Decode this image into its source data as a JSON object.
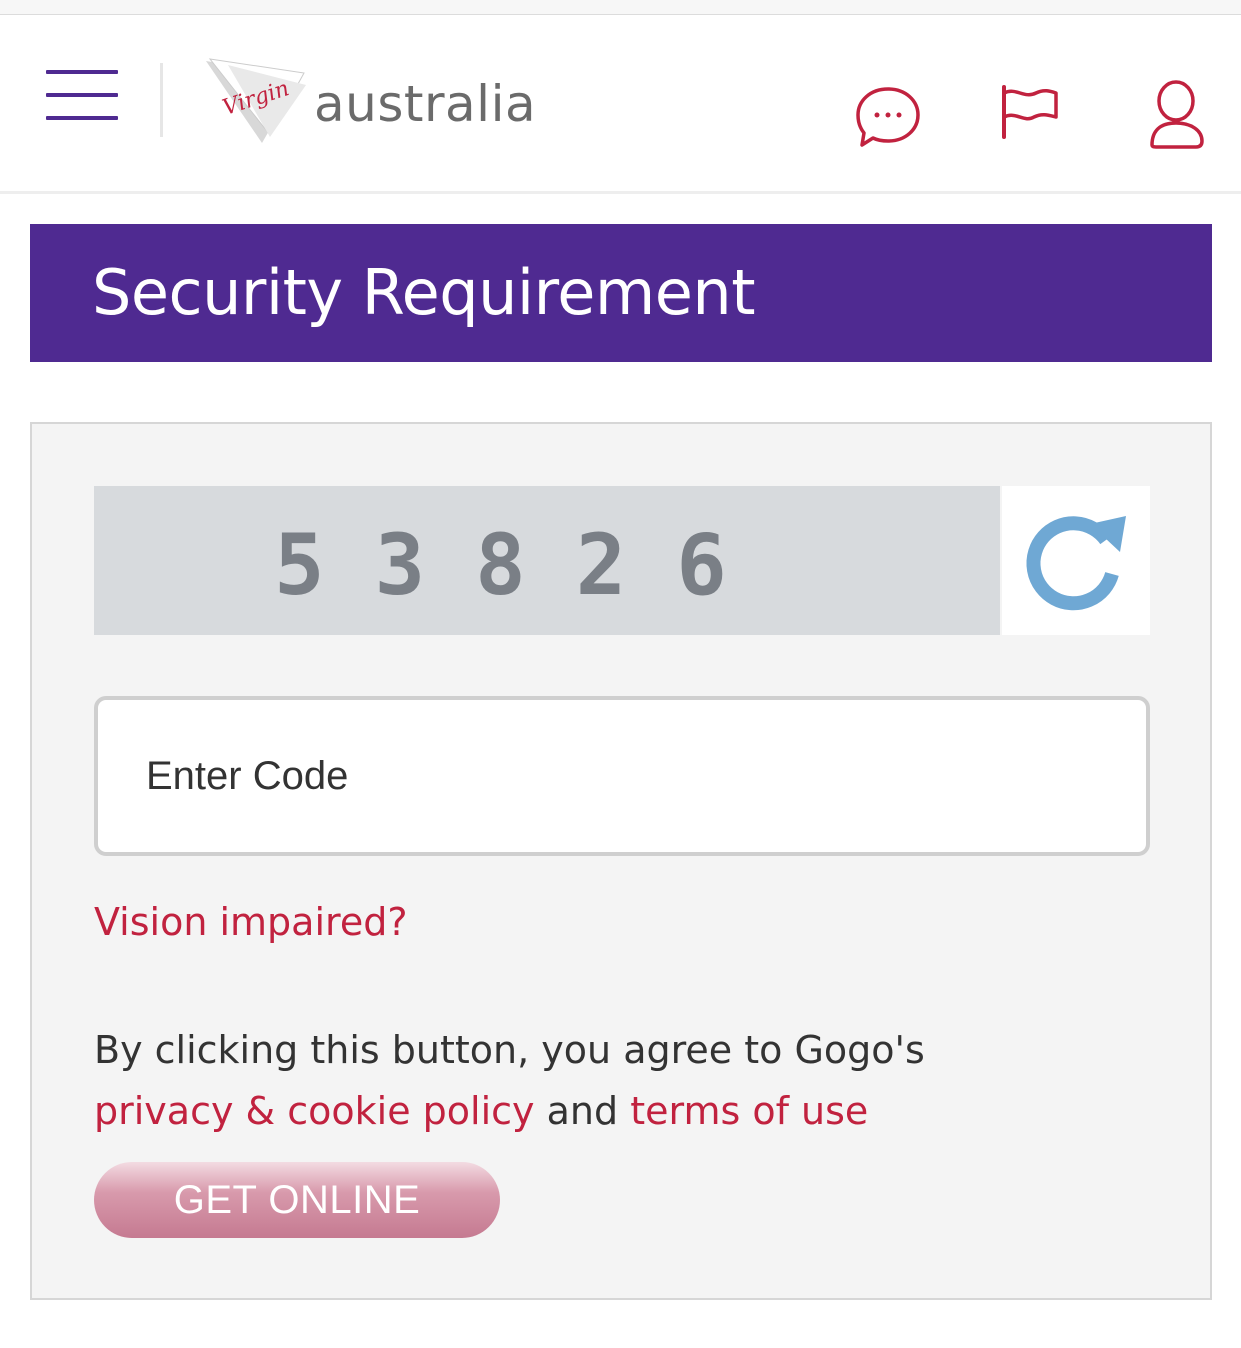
{
  "header": {
    "brand_script": "Virgin",
    "brand_word": "australia",
    "icons": [
      "menu-icon",
      "chat-icon",
      "flag-icon",
      "user-icon"
    ],
    "brand_color": "#4f2a91",
    "accent_color": "#c1223f"
  },
  "banner": {
    "title": "Security Requirement"
  },
  "captcha": {
    "code": "53826",
    "refresh_icon": "refresh-icon",
    "refresh_color": "#6fa8d4"
  },
  "form": {
    "code_placeholder": "Enter Code",
    "code_value": "",
    "vision_link": "Vision impaired?",
    "agree_text": "By clicking this button, you agree to Gogo's",
    "privacy_link": "privacy & cookie policy",
    "and_text": "and",
    "terms_link": "terms of use",
    "submit_label": "GET ONLINE"
  }
}
